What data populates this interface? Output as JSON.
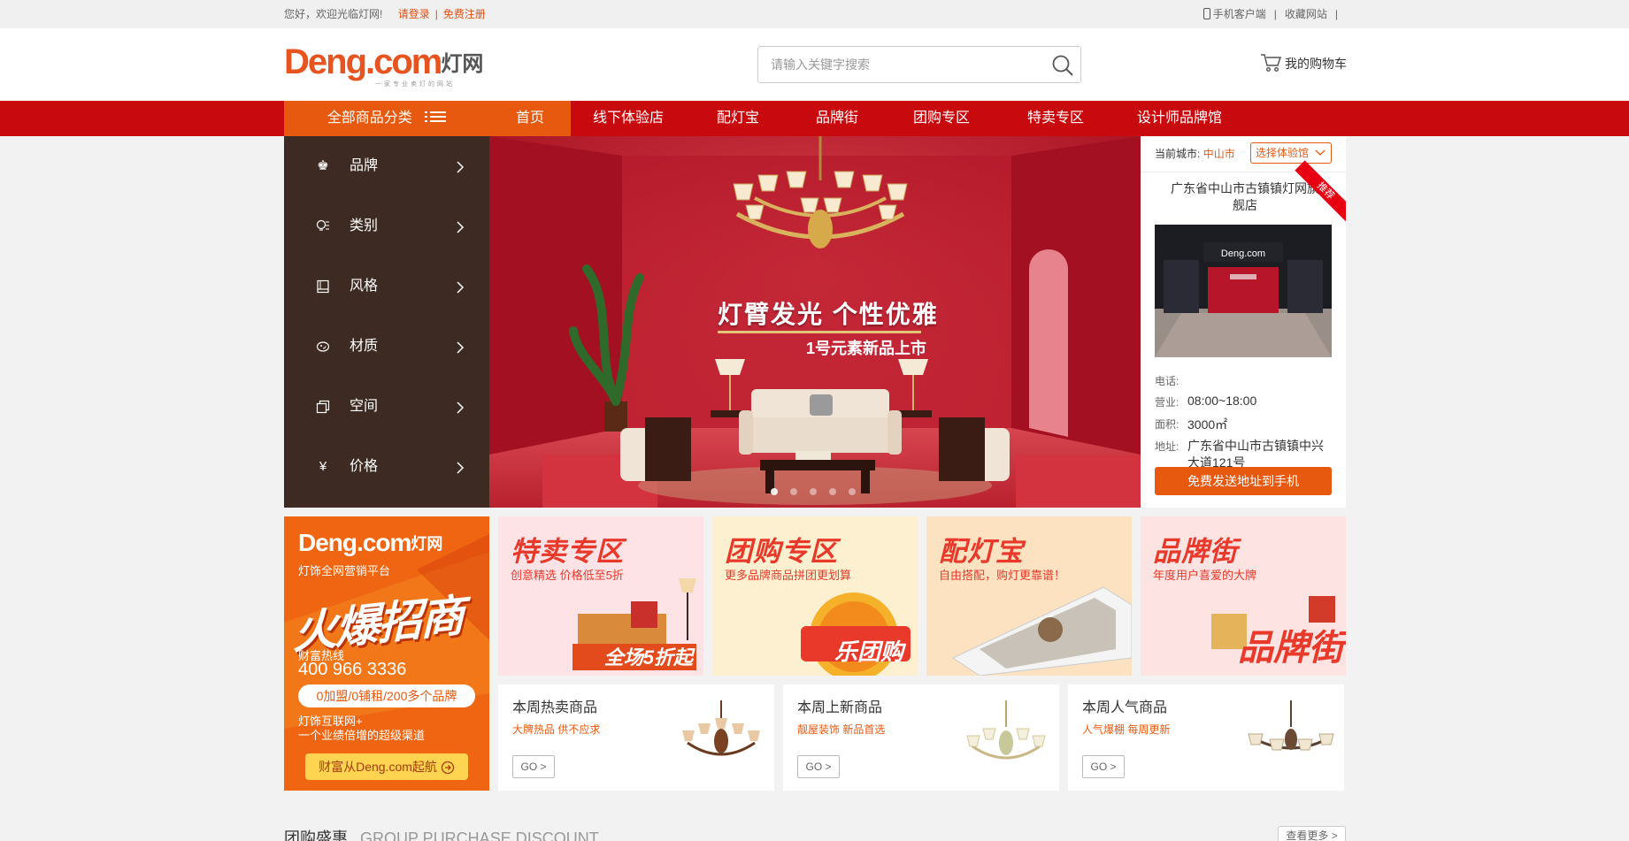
{
  "topbar": {
    "welcome": "您好，欢迎光临灯网!",
    "login": "请登录",
    "register": "免费注册",
    "mobile_client": "手机客户端",
    "favorite": "收藏网站"
  },
  "header": {
    "logo_main": "Deng.com",
    "logo_cn": "灯网",
    "logo_tagline": "一家专业卖灯的网站",
    "search_placeholder": "请输入关键字搜索",
    "cart_label": "我的购物车"
  },
  "nav": {
    "all_categories": "全部商品分类",
    "items": [
      "首页",
      "线下体验店",
      "配灯宝",
      "品牌街",
      "团购专区",
      "特卖专区",
      "设计师品牌馆"
    ],
    "active_index": 0
  },
  "sidebar": {
    "items": [
      {
        "label": "品牌",
        "icon": "crown-icon"
      },
      {
        "label": "类别",
        "icon": "bulb-icon"
      },
      {
        "label": "风格",
        "icon": "book-icon"
      },
      {
        "label": "材质",
        "icon": "material-icon"
      },
      {
        "label": "空间",
        "icon": "space-icon"
      },
      {
        "label": "价格",
        "icon": "yen-icon"
      }
    ],
    "arrow": ">"
  },
  "banner": {
    "title": "灯臂发光 个性优雅",
    "subtitle": "1号元素新品上市",
    "slide_count": 5,
    "active_slide": 0
  },
  "store": {
    "city_label": "当前城市:",
    "city": "中山市",
    "select_label": "选择体验馆",
    "name": "广东省中山市古镇镇灯网旗舰店",
    "ribbon": "推荐",
    "phone_label": "电话:",
    "hours_label": "营业:",
    "hours": "08:00~18:00",
    "area_label": "面积:",
    "area": "3000㎡",
    "address_label": "地址:",
    "address": "广东省中山市古镇镇中兴大道121号",
    "send_button": "免费发送地址到手机"
  },
  "promo": {
    "logo": "Deng.com",
    "logo_cn": "灯网",
    "platform": "灯饰全网营销平台",
    "headline": "火爆招商",
    "hotline_label": "财富热线",
    "hotline": "400 966 3336",
    "pill": "0加盟/0铺租/200多个品牌",
    "net_line1": "灯饰互联网+",
    "net_line2": "一个业绩倍增的超级渠道",
    "button": "财富从Deng.com起航"
  },
  "zones": [
    {
      "title": "特卖专区",
      "subtitle": "创意精选  价格低至5折",
      "badge": "全场5折起",
      "bg": "#fde3e6"
    },
    {
      "title": "团购专区",
      "subtitle": "更多品牌商品拼团更划算",
      "badge": "乐团购",
      "bg": "#fdf0d0"
    },
    {
      "title": "配灯宝",
      "subtitle": "自由搭配，购灯更靠谱！",
      "badge": "",
      "bg": "#fde2c2"
    },
    {
      "title": "品牌街",
      "subtitle": "年度用户喜爱的大牌",
      "badge": "品牌街",
      "bg": "#fde3e2"
    }
  ],
  "weekly": [
    {
      "title": "本周热卖商品",
      "subtitle": "大牌热品 供不应求",
      "go": "GO >"
    },
    {
      "title": "本周上新商品",
      "subtitle": "靓屋装饰 新品首选",
      "go": "GO >"
    },
    {
      "title": "本周人气商品",
      "subtitle": "人气爆棚 每周更新",
      "go": "GO >"
    }
  ],
  "section": {
    "title": "团购盛惠",
    "title_en": "GROUP PURCHASE DISCOUNT",
    "more": "查看更多 >"
  },
  "colors": {
    "brand_orange": "#e7590f",
    "nav_red": "#c8090e",
    "sidebar_brown": "#3d2a22"
  }
}
